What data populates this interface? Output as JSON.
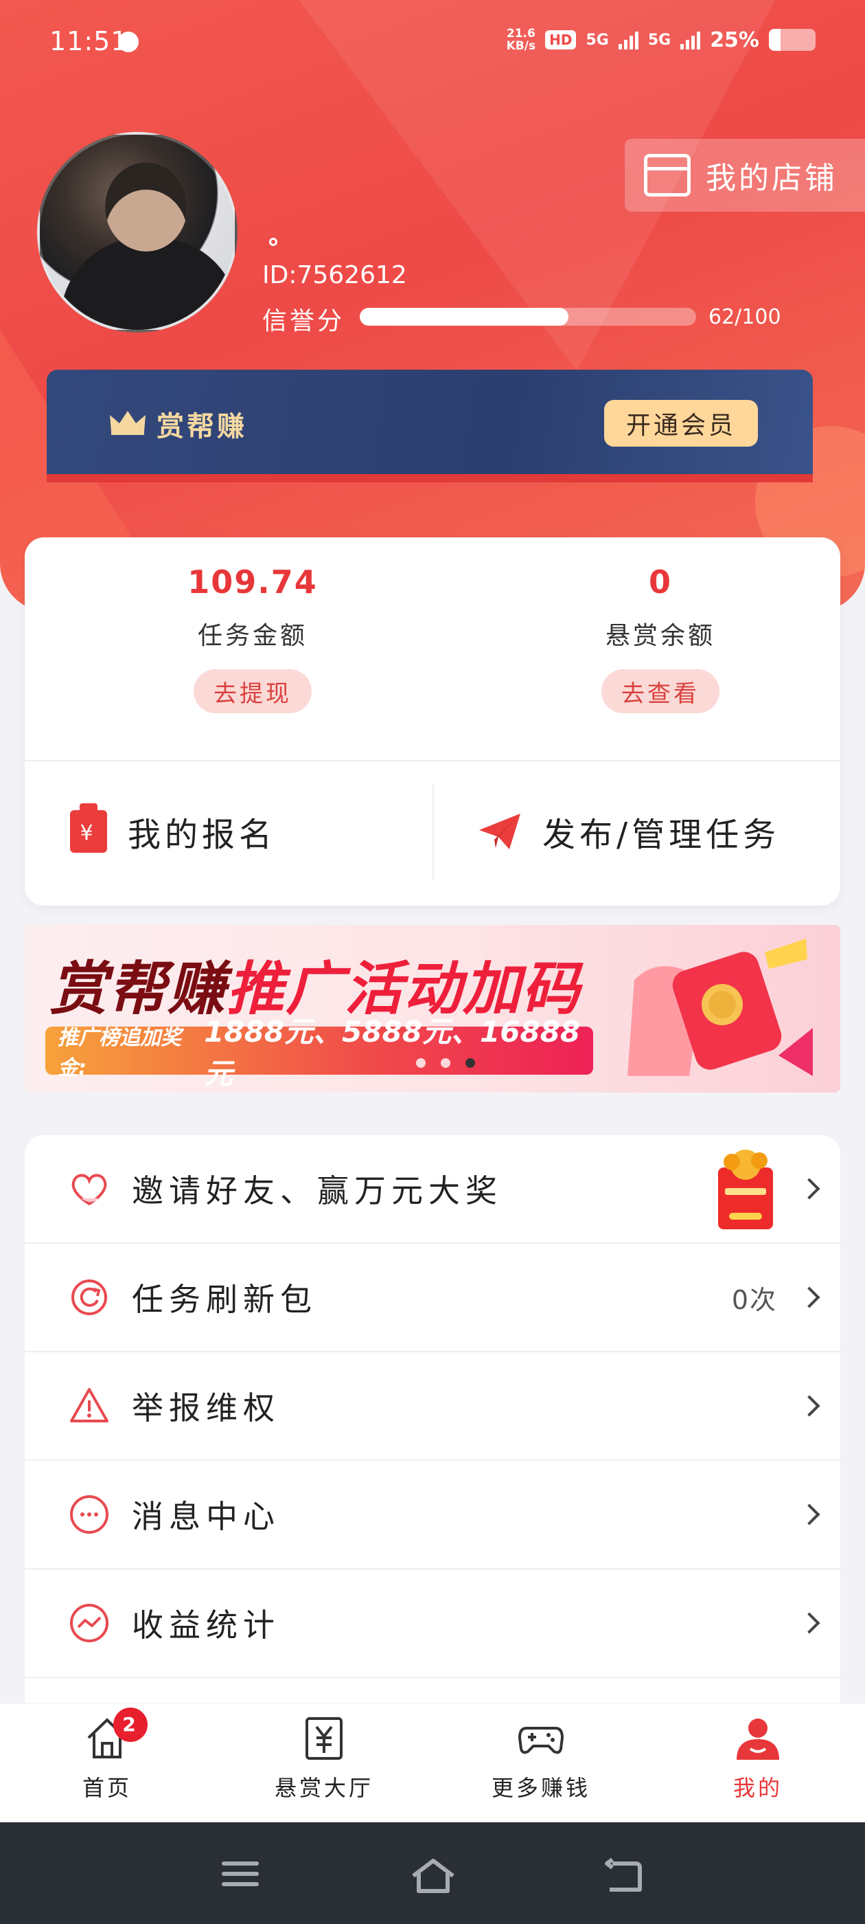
{
  "status_bar": {
    "time": "11:51",
    "net_speed_value": "21.6",
    "net_speed_unit": "KB/s",
    "hd": "HD",
    "net1": "5G",
    "net2": "5G",
    "battery": "25%"
  },
  "profile": {
    "id": "ID:7562612",
    "credit_label": "信誉分",
    "credit_value": "62/100",
    "credit_fraction": 0.62,
    "shop_button": "我的店铺"
  },
  "vip": {
    "title": "赏帮赚",
    "button": "开通会员"
  },
  "wallet": {
    "task_amount": "109.74",
    "task_amount_label": "任务金额",
    "withdraw_button": "去提现",
    "reward_balance": "0",
    "reward_balance_label": "悬赏余额",
    "view_button": "去查看"
  },
  "actions": {
    "my_signup": "我的报名",
    "publish_manage": "发布/管理任务"
  },
  "banner": {
    "title_a": "赏帮赚",
    "title_b": "推广活动加码",
    "strip_prefix": "推广榜追加奖金:",
    "strip_amounts": "1888元、5888元、16888元",
    "active_dot": 3
  },
  "menu": {
    "items": [
      {
        "label": "邀请好友、赢万元大奖",
        "icon": "heart-icon"
      },
      {
        "label": "任务刷新包",
        "icon": "refresh-icon",
        "value": "0次"
      },
      {
        "label": "举报维权",
        "icon": "warning-icon"
      },
      {
        "label": "消息中心",
        "icon": "message-icon"
      },
      {
        "label": "收益统计",
        "icon": "chart-icon"
      }
    ]
  },
  "tabs": [
    {
      "label": "首页",
      "icon": "home-icon",
      "badge": "2"
    },
    {
      "label": "悬赏大厅",
      "icon": "yuan-icon"
    },
    {
      "label": "更多赚钱",
      "icon": "gamepad-icon"
    },
    {
      "label": "我的",
      "icon": "user-icon",
      "active": true
    }
  ],
  "colors": {
    "brand_red": "#ee4a47",
    "accent_red": "#e8373a",
    "vip_navy": "#2c3f6f",
    "vip_gold": "#ffd79a"
  }
}
